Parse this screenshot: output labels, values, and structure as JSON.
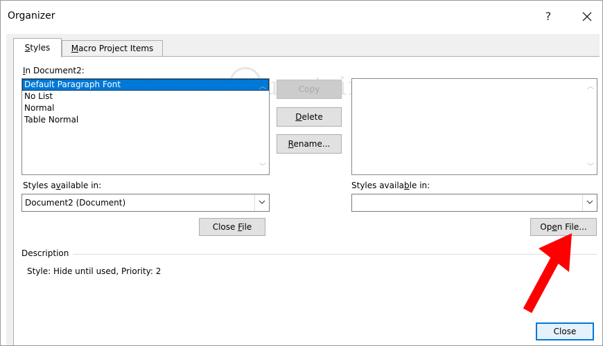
{
  "window": {
    "title": "Organizer",
    "help": "?",
    "close": "✕"
  },
  "tabs": [
    {
      "label": "Styles",
      "accel": "S",
      "rest": "tyles"
    },
    {
      "label": "Macro Project Items",
      "accel": "M",
      "rest": "acro Project Items"
    }
  ],
  "watermark": "uantrimang",
  "left": {
    "in_label_pre": "",
    "in_label_accel": "I",
    "in_label_post": "n Document2:",
    "items": [
      "Default Paragraph Font",
      "No List",
      "Normal",
      "Table Normal"
    ],
    "selected_index": 0,
    "styles_avail_pre": "Styles a",
    "styles_avail_accel": "v",
    "styles_avail_post": "ailable in:",
    "combo_value": "Document2 (Document)",
    "close_file_pre": "Close ",
    "close_file_accel": "F",
    "close_file_post": "ile"
  },
  "middle": {
    "copy": "Copy",
    "delete_accel": "D",
    "delete_rest": "elete",
    "rename_accel": "R",
    "rename_rest": "ename..."
  },
  "right": {
    "styles_avail_pre": "Styles availa",
    "styles_avail_accel": "b",
    "styles_avail_post": "le in:",
    "combo_value": "",
    "open_file_pre": "Op",
    "open_file_accel": "e",
    "open_file_post": "n File..."
  },
  "description": {
    "heading": "Description",
    "text": "Style: Hide until used, Priority: 2"
  },
  "footer": {
    "close": "Close"
  },
  "colors": {
    "arrow": "#ff0000",
    "selection": "#0078d7"
  }
}
